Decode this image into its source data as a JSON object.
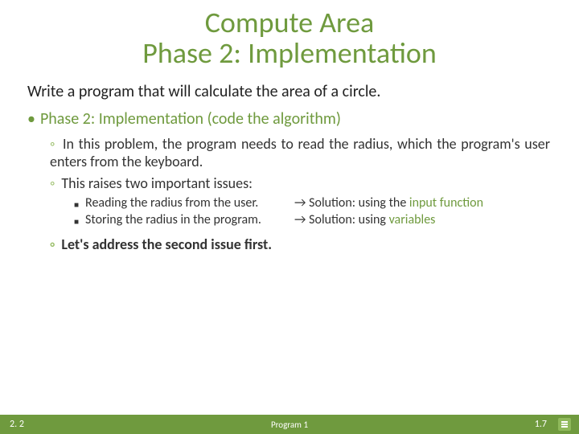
{
  "title_line1": "Compute Area",
  "title_line2": "Phase 2: Implementation",
  "intro": "Write a program that will calculate the area of a circle.",
  "phase_heading": "Phase 2: Implementation (code the algorithm)",
  "sub1": "In this problem, the program needs to read the radius, which the program's user enters from the keyboard.",
  "sub2": "This raises two important issues:",
  "issue1_left": "Reading the radius from the user.",
  "issue1_right_prefix": "→ Solution: using the ",
  "issue1_right_kw": "input function",
  "issue2_left": "Storing the radius in the program.",
  "issue2_right_prefix": "→ Solution: using ",
  "issue2_right_kw": "variables",
  "sub3": "Let's address the second issue first.",
  "footer_section": "2. 2",
  "footer_mid": "Program 1",
  "footer_page": "1.7"
}
